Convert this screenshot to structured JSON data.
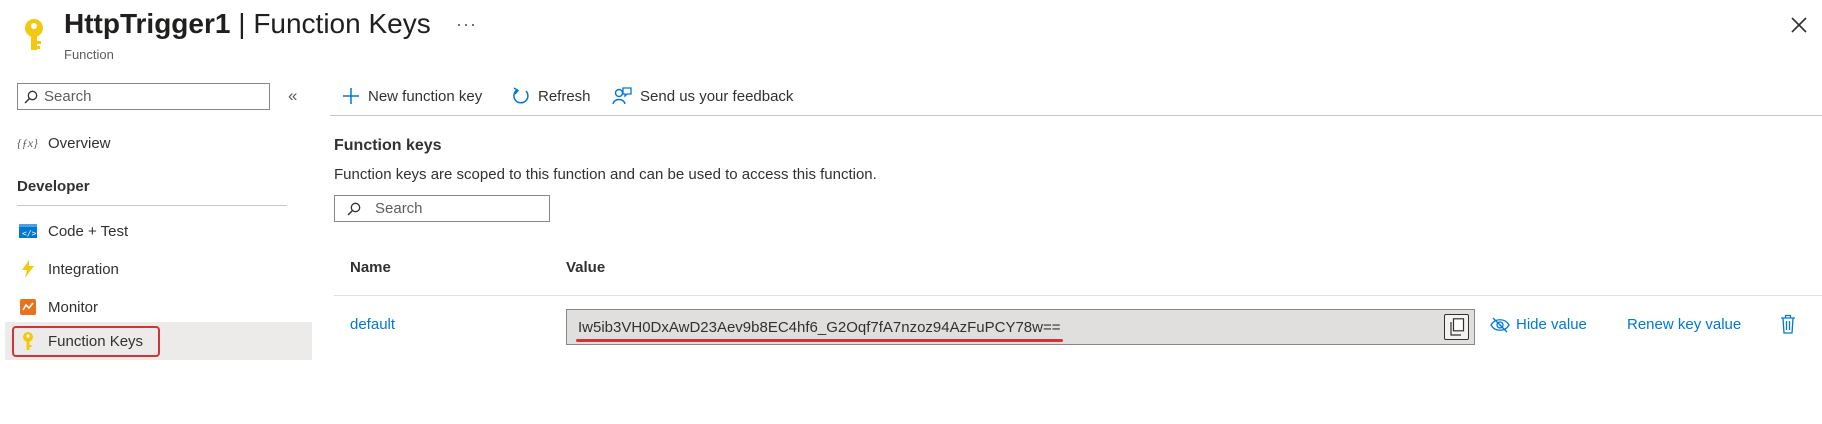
{
  "header": {
    "title_name": "HttpTrigger1",
    "title_separator": " | ",
    "title_page": "Function Keys",
    "subtitle": "Function",
    "more_icon": "ellipsis-icon",
    "close_icon": "close-icon"
  },
  "sidebar": {
    "search_placeholder": "Search",
    "collapse_icon": "double-chevron-left-icon",
    "items": [
      {
        "label": "Overview",
        "icon": "function-fx-icon"
      },
      {
        "label": "Code + Test",
        "icon": "code-icon"
      },
      {
        "label": "Integration",
        "icon": "lightning-icon"
      },
      {
        "label": "Monitor",
        "icon": "monitor-icon"
      },
      {
        "label": "Function Keys",
        "icon": "key-icon",
        "selected": true
      }
    ],
    "section_developer": "Developer"
  },
  "toolbar": {
    "new_key_label": "New function key",
    "refresh_label": "Refresh",
    "feedback_label": "Send us your feedback"
  },
  "main": {
    "heading": "Function keys",
    "description": "Function keys are scoped to this function and can be used to access this function.",
    "search_placeholder": "Search",
    "columns": {
      "name": "Name",
      "value": "Value"
    },
    "rows": [
      {
        "name": "default",
        "value": "Iw5ib3VH0DxAwD23Aev9b8EC4hf6_G2Oqf7fA7nzoz94AzFuPCY78w==",
        "hide_label": "Hide value",
        "renew_label": "Renew key value"
      }
    ]
  },
  "colors": {
    "accent": "#0078d4",
    "highlight_red": "#d13438",
    "key_yellow": "#f2c811"
  }
}
